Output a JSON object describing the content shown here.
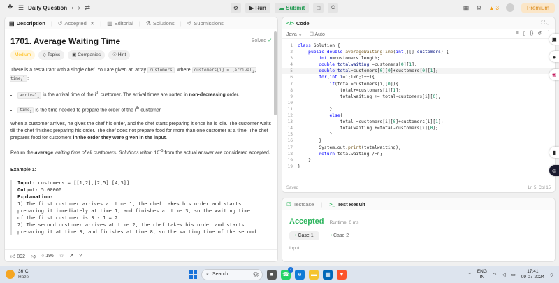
{
  "topbar": {
    "title": "Daily Question",
    "run_label": "Run",
    "submit_label": "Submit",
    "streak": "3",
    "premium_label": "Premium"
  },
  "left_tabs": {
    "description": "Description",
    "accepted": "Accepted",
    "editorial": "Editorial",
    "solutions": "Solutions",
    "submissions": "Submissions"
  },
  "problem": {
    "title": "1701. Average Waiting Time",
    "solved": "Solved",
    "difficulty": "Medium",
    "topics": "Topics",
    "companies": "Companies",
    "hint": "Hint",
    "p1_a": "There is a restaurant with a single chef. You are given an array ",
    "p1_code1": "customers",
    "p1_b": ", where ",
    "p1_code2": "customers[i] = [arrival",
    "p1_code2_sub": "i",
    "p1_code2_c": ", time",
    "p1_code2_sub2": "i",
    "p1_code2_d": "]",
    "p1_c": ":",
    "bullet1_code": "arrival",
    "bullet1_sub": "i",
    "bullet1_a": " is the arrival time of the ",
    "bullet1_sup": "th",
    "bullet1_b": " customer. The arrival times are sorted in ",
    "bullet1_bold": "non-decreasing",
    "bullet1_c": " order.",
    "bullet2_code": "time",
    "bullet2_sub": "i",
    "bullet2_a": " is the time needed to prepare the order of the ",
    "bullet2_sup": "th",
    "bullet2_b": " customer.",
    "p2_a": "When a customer arrives, he gives the chef his order, and the chef starts preparing it once he is idle. The customer waits till the chef finishes preparing his order. The chef does not prepare food for more than one customer at a time. The chef prepares food for customers ",
    "p2_bold": "in the order they were given in the input",
    "p2_b": ".",
    "p3_a": "Return the ",
    "p3_bold": "average",
    "p3_b": " waiting time of all customers. Solutions within ",
    "p3_c": " from the actual answer are considered accepted.",
    "tolerance": "10",
    "tolerance_exp": "-5",
    "i_var": "i",
    "example_title": "Example 1:",
    "ex_input_label": "Input:",
    "ex_input": " customers = [[1,2],[2,5],[4,3]]",
    "ex_output_label": "Output:",
    "ex_output": " 5.00000",
    "ex_expl_label": "Explanation:",
    "ex_line1": "1) The first customer arrives at time 1, the chef takes his order and starts",
    "ex_line2": "preparing it immediately at time 1, and finishes at time 3, so the waiting time",
    "ex_line3": "of the first customer is 3 - 1 = 2.",
    "ex_line4": "2) The second customer arrives at time 2, the chef takes his order and starts",
    "ex_line5": "preparing it at time 3, and finishes at time 8, so the waiting time of the second"
  },
  "footer": {
    "likes": "892",
    "comments": "196"
  },
  "editor": {
    "tab": "Code",
    "language": "Java",
    "mode": "Auto",
    "saved": "Saved",
    "position": "Ln 5, Col 15"
  },
  "result": {
    "tab_testcase": "Testcase",
    "tab_result": "Test Result",
    "status": "Accepted",
    "runtime": "Runtime: 0 ms",
    "case1": "Case 1",
    "case2": "Case 2",
    "input_label": "Input"
  },
  "taskbar": {
    "temperature": "36°C",
    "weather": "Haze",
    "search": "Search",
    "lang1": "ENG",
    "lang2": "IN",
    "time": "17:41",
    "date": "09-07-2024",
    "badge": "2"
  },
  "icons": {
    "run": "play-icon",
    "submit": "cloud-upload-icon",
    "code": "code-icon"
  }
}
